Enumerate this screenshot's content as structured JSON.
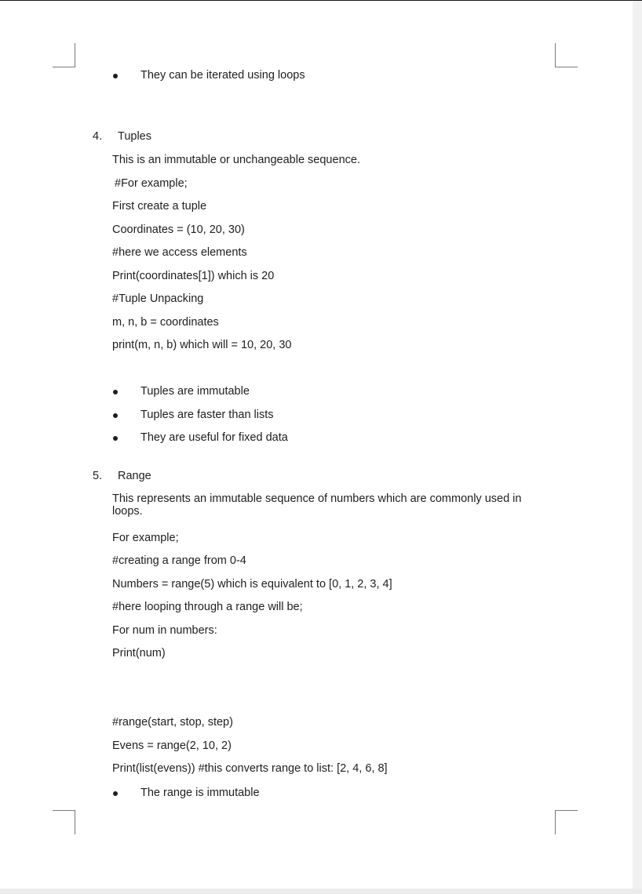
{
  "document": {
    "top_bullets": [
      "They can be iterated using loops"
    ],
    "section4": {
      "number": "4.",
      "title": "Tuples",
      "lines": [
        "This is an immutable or unchangeable sequence.",
        "#For example;",
        "First create a tuple",
        "Coordinates = (10, 20, 30)",
        "#here we access elements",
        "Print(coordinates[1]) which is 20",
        "#Tuple Unpacking",
        "m, n, b = coordinates",
        "print(m, n, b) which will = 10, 20, 30"
      ],
      "bullets": [
        "Tuples are immutable",
        "Tuples are faster than lists",
        "They are useful for fixed data"
      ]
    },
    "section5": {
      "number": "5.",
      "title": "Range",
      "intro": "This represents an immutable sequence of numbers which are commonly used in loops.",
      "lines": [
        "For example;",
        "#creating a range from 0-4",
        "Numbers = range(5) which is equivalent to [0, 1, 2, 3, 4]",
        "#here looping through a range will be;",
        "For num in numbers:",
        "Print(num)"
      ],
      "lines2": [
        "#range(start, stop, step)",
        "Evens = range(2, 10, 2)",
        "Print(list(evens)) #this converts range to list: [2, 4, 6, 8]"
      ],
      "bullets": [
        "The range is immutable"
      ]
    }
  }
}
